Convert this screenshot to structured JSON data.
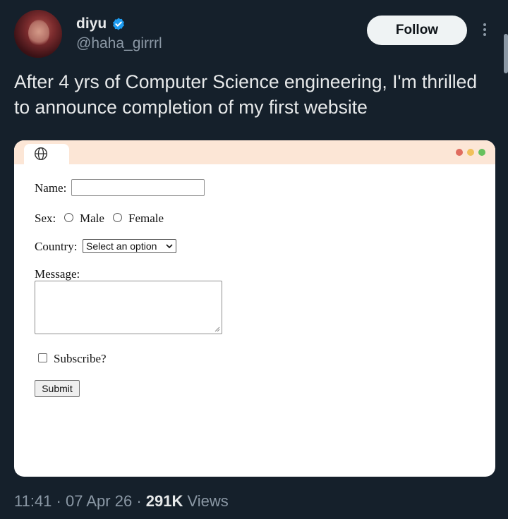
{
  "author": {
    "display_name": "diyu",
    "handle": "@haha_girrrl",
    "verified": true,
    "avatar_icon": "profile-photo"
  },
  "actions": {
    "follow_label": "Follow",
    "more_icon": "more-vertical-icon"
  },
  "tweet": {
    "text": "After 4 yrs of Computer Science engineering, I'm thrilled to announce completion of my first website"
  },
  "mockup": {
    "tab_icon": "globe-icon",
    "window_dots": [
      "#e06c5f",
      "#f1c05a",
      "#67c15e"
    ],
    "bar_color": "#fce6d6",
    "form": {
      "name_label": "Name:",
      "name_value": "",
      "sex_label": "Sex:",
      "sex_options": [
        "Male",
        "Female"
      ],
      "country_label": "Country:",
      "country_selected": "Select an option",
      "message_label": "Message:",
      "message_value": "",
      "subscribe_label": "Subscribe?",
      "submit_label": "Submit"
    }
  },
  "meta": {
    "time": "11:41",
    "separator1": "·",
    "date": "07 Apr 26",
    "separator2": "·",
    "views_count": "291K",
    "views_label": "Views"
  },
  "colors": {
    "background": "#15202b",
    "verified_badge": "#1d9bf0",
    "secondary_text": "#8b98a5"
  }
}
